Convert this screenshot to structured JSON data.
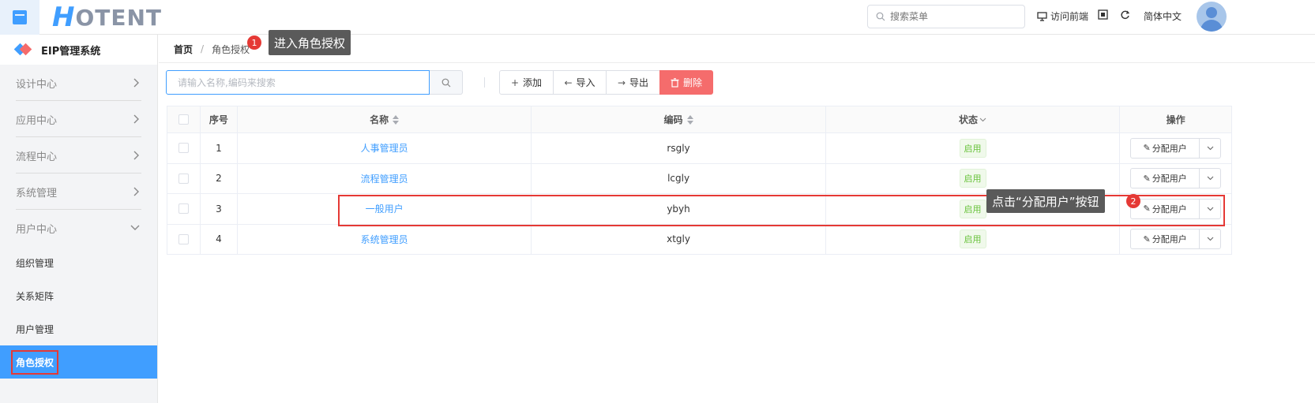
{
  "header": {
    "logo_h": "H",
    "logo_rest": "OTENT",
    "search_placeholder": "搜索菜单",
    "visit_front": "访问前端",
    "language": "简体中文"
  },
  "sidebar": {
    "system_title": "EIP管理系统",
    "groups": [
      {
        "label": "设计中心"
      },
      {
        "label": "应用中心"
      },
      {
        "label": "流程中心"
      },
      {
        "label": "系统管理"
      },
      {
        "label": "用户中心"
      }
    ],
    "sub_items": [
      {
        "label": "组织管理"
      },
      {
        "label": "关系矩阵"
      },
      {
        "label": "用户管理"
      },
      {
        "label": "角色授权"
      }
    ]
  },
  "breadcrumb": {
    "home": "首页",
    "separator": "/",
    "current": "角色授权"
  },
  "annotations": {
    "step1_number": "1",
    "step1_text": "进入角色授权",
    "step2_number": "2",
    "step2_text": "点击“分配用户”按钮"
  },
  "toolbar": {
    "search_placeholder": "请输入名称,编码来搜索",
    "add_label": "添加",
    "import_label": "导入",
    "export_label": "导出",
    "delete_label": "删除"
  },
  "table": {
    "headers": {
      "index": "序号",
      "name": "名称",
      "code": "编码",
      "status": "状态",
      "action": "操作"
    },
    "rows": [
      {
        "index": "1",
        "name": "人事管理员",
        "code": "rsgly",
        "status": "启用",
        "action": "分配用户"
      },
      {
        "index": "2",
        "name": "流程管理员",
        "code": "lcgly",
        "status": "启用",
        "action": "分配用户"
      },
      {
        "index": "3",
        "name": "一般用户",
        "code": "ybyh",
        "status": "启用",
        "action": "分配用户"
      },
      {
        "index": "4",
        "name": "系统管理员",
        "code": "xtgly",
        "status": "启用",
        "action": "分配用户"
      }
    ]
  },
  "colors": {
    "primary": "#409eff",
    "danger": "#f56c6c",
    "success": "#67c23a",
    "highlight": "#e53935",
    "callout_bg": "#5a5a5a"
  }
}
